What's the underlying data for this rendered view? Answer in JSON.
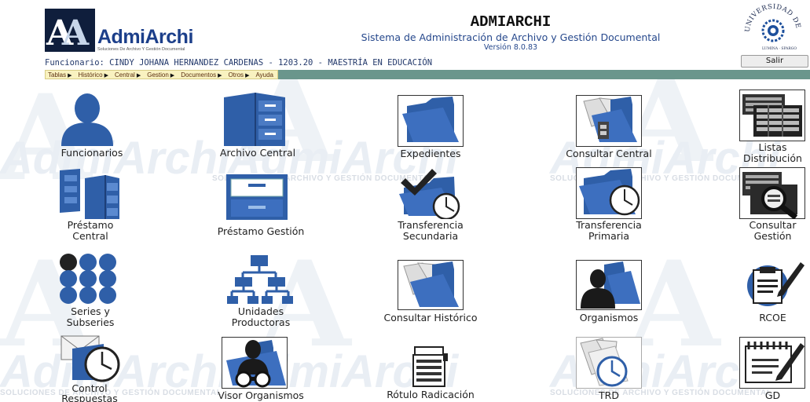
{
  "header": {
    "logo_text": "AdmiArchi",
    "logo_subtext": "Soluciones De Archivo Y Gestión Documental",
    "app_title": "ADMIARCHI",
    "app_subtitle": "Sistema de Administración de Archivo y Gestión Documental",
    "app_version": "Versión 8.0.83",
    "seal_text": "UNIVERSIDAD DE CALDAS",
    "logout_label": "Salir",
    "user_line": "Funcionario: CINDY JOHANA HERNANDEZ CARDENAS - 1203.20 - MAESTRÍA EN EDUCACIÓN"
  },
  "menu": [
    {
      "label": "Tablas"
    },
    {
      "label": "Histórico"
    },
    {
      "label": "Central"
    },
    {
      "label": "Gestion"
    },
    {
      "label": "Documentos"
    },
    {
      "label": "Otros"
    },
    {
      "label": "Ayuda"
    }
  ],
  "tiles": [
    {
      "id": "funcionarios",
      "label1": "Funcionarios",
      "label2": "",
      "icon": "person-silhouette-icon"
    },
    {
      "id": "archivo-central",
      "label1": "Archivo Central",
      "label2": "",
      "icon": "filing-cabinet-icon"
    },
    {
      "id": "expedientes",
      "label1": "Expedientes",
      "label2": "",
      "icon": "folder-icon"
    },
    {
      "id": "consultar-central",
      "label1": "Consultar Central",
      "label2": "",
      "icon": "folder-documents-cabinet-icon"
    },
    {
      "id": "listas-distribucion",
      "label1": "Listas",
      "label2": "Distribución",
      "icon": "stacked-lists-icon"
    },
    {
      "id": "prestamo-central",
      "label1": "Préstamo",
      "label2": "Central",
      "icon": "two-cabinets-icon"
    },
    {
      "id": "prestamo-gestion",
      "label1": "Préstamo Gestión",
      "label2": "",
      "icon": "drawer-cabinet-icon"
    },
    {
      "id": "transferencia-secundaria",
      "label1": "Transferencia",
      "label2": "Secundaria",
      "icon": "folder-check-clock-icon"
    },
    {
      "id": "transferencia-primaria",
      "label1": "Transferencia",
      "label2": "Primaria",
      "icon": "folder-clock-icon"
    },
    {
      "id": "consultar-gestion",
      "label1": "Consultar",
      "label2": "Gestión",
      "icon": "lists-magnifier-icon"
    },
    {
      "id": "series-subseries",
      "label1": "Series y",
      "label2": "Subseries",
      "icon": "dot-grid-icon"
    },
    {
      "id": "unidades-productoras",
      "label1": "Unidades",
      "label2": "Productoras",
      "icon": "org-chart-icon"
    },
    {
      "id": "consultar-historico",
      "label1": "Consultar Histórico",
      "label2": "",
      "icon": "folder-papers-icon"
    },
    {
      "id": "organismos",
      "label1": "Organismos",
      "label2": "",
      "icon": "folder-person-icon"
    },
    {
      "id": "rcoe",
      "label1": "RCOE",
      "label2": "",
      "icon": "clipboard-pen-icon"
    },
    {
      "id": "control-respuestas",
      "label1": "Control",
      "label2": "Respuestas",
      "icon": "envelope-clock-icon"
    },
    {
      "id": "visor-organismos",
      "label1": "Visor Organismos",
      "label2": "",
      "icon": "folder-binoculars-icon"
    },
    {
      "id": "rotulo-radicacion",
      "label1": "Rótulo Radicación",
      "label2": "",
      "icon": "label-printer-icon"
    },
    {
      "id": "trd",
      "label1": "TRD",
      "label2": "",
      "icon": "papers-clock-icon"
    },
    {
      "id": "gd",
      "label1": "GD",
      "label2": "",
      "icon": "notepad-pen-icon"
    }
  ],
  "watermark": {
    "brand": "AdmiArchi",
    "slogan": "SOLUCIONES DE ARCHIVO Y GESTIÓN DOCUMENTAL"
  },
  "colors": {
    "icon_blue": "#2f5fa8",
    "icon_dark": "#1a1a1a",
    "menubar_teal": "#6a968c",
    "menu_bg": "#f9f2c0",
    "title_blue": "#26488c"
  }
}
